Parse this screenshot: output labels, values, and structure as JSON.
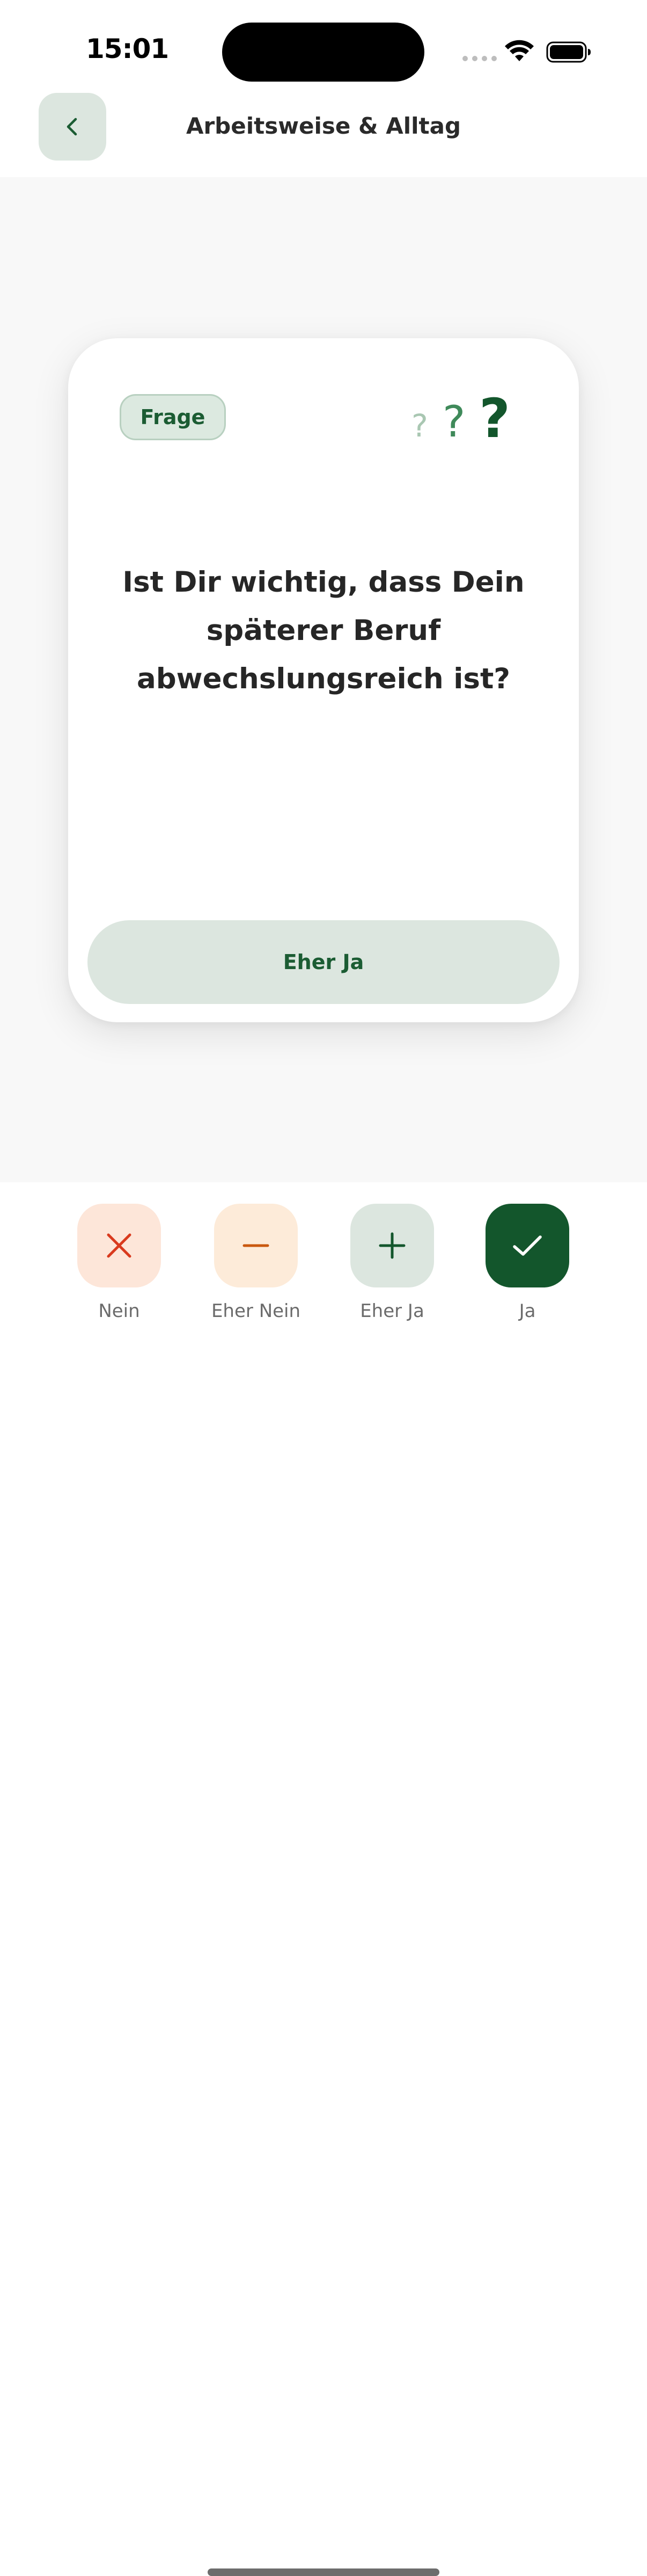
{
  "status_bar": {
    "time": "15:01"
  },
  "header": {
    "title": "Arbeitsweise & Alltag",
    "back_icon": "chevron-left-icon"
  },
  "card": {
    "chip_label": "Frage",
    "decoration_icon": "question-marks-icon",
    "question": "Ist Dir wichtig, dass Dein späterer Beruf abwechslungsreich ist?",
    "selected_answer": "Eher Ja"
  },
  "answers": [
    {
      "label": "Nein",
      "icon": "close-icon",
      "color": "#d93a1e"
    },
    {
      "label": "Eher Nein",
      "icon": "minus-icon",
      "color": "#c9580f"
    },
    {
      "label": "Eher Ja",
      "icon": "plus-icon",
      "color": "#13562c"
    },
    {
      "label": "Ja",
      "icon": "check-icon",
      "color": "#ffffff"
    }
  ],
  "colors": {
    "brand_green": "#13562c",
    "light_green": "#dce6df",
    "nein_bg": "#fde6d9",
    "eher_nein_bg": "#fdebd9"
  }
}
